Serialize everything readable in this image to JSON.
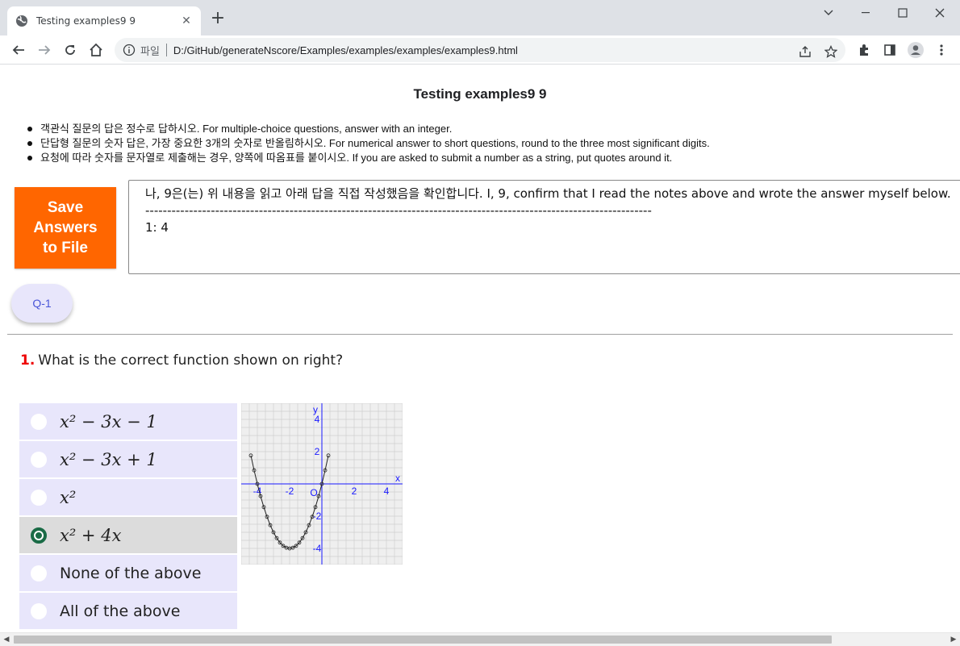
{
  "browser": {
    "tab_title": "Testing examples9 9",
    "new_tab_symbol": "+",
    "address_scheme": "파일",
    "url": "D:/GitHub/generateNscore/Examples/examples/examples/examples9.html"
  },
  "page": {
    "title": "Testing examples9 9",
    "notes": [
      "객관식 질문의 답은 정수로 답하시오. For multiple-choice questions, answer with an integer.",
      "단답형 질문의 숫자 답은, 가장 중요한 3개의 숫자로 반올림하시오. For numerical answer to short questions, round to the three most significant digits.",
      "요청에 따라 숫자를 문자열로 제출해는 경우, 양쪽에 따옴표를 붙이시오. If you are asked to submit a number as a string, put quotes around it."
    ],
    "save_button": "Save Answers to File",
    "answer_box": {
      "line1": "나, 9은(는) 위 내용을 읽고 아래 답을 직접 작성했음을 확인합니다. I, 9, confirm that I read the notes above and wrote the answer myself below.",
      "line2": "--------------------------------------------------------------------------------------------------------------------",
      "line3": "1: 4"
    },
    "question_nav": "Q-1",
    "question": {
      "number": "1.",
      "text": "What is the correct function shown on right?",
      "options": [
        {
          "label": "x² − 3x − 1",
          "selected": false
        },
        {
          "label": "x² − 3x + 1",
          "selected": false
        },
        {
          "label": "x²",
          "selected": false
        },
        {
          "label": "x² + 4x",
          "selected": true
        },
        {
          "label": "None of the above",
          "selected": false
        },
        {
          "label": "All of the above",
          "selected": false
        }
      ]
    }
  },
  "chart_data": {
    "type": "line",
    "function": "x^2 + 4x",
    "x_range": [
      -5,
      5
    ],
    "y_range": [
      -5,
      5
    ],
    "x_axis_label": "x",
    "y_axis_label": "y",
    "origin_label": "O",
    "x_ticks": [
      "-4",
      "-2",
      "2",
      "4"
    ],
    "y_ticks": [
      "4",
      "2",
      "-2",
      "-4"
    ],
    "grid": true,
    "series": [
      {
        "x": [
          -4.4,
          -4.2,
          -4.0,
          -3.8,
          -3.6,
          -3.4,
          -3.2,
          -3.0,
          -2.8,
          -2.6,
          -2.4,
          -2.2,
          -2.0,
          -1.8,
          -1.6,
          -1.4,
          -1.2,
          -1.0,
          -0.8,
          -0.6,
          -0.4,
          -0.2,
          0.0,
          0.2,
          0.4
        ],
        "y": [
          1.76,
          0.84,
          0.0,
          -0.76,
          -1.44,
          -2.04,
          -2.56,
          -3.0,
          -3.36,
          -3.64,
          -3.84,
          -3.96,
          -4.0,
          -3.96,
          -3.84,
          -3.64,
          -3.36,
          -3.0,
          -2.56,
          -2.04,
          -1.44,
          -0.76,
          0.0,
          0.84,
          1.76
        ]
      }
    ],
    "colors": {
      "axis": "#1a1aff",
      "curve": "#222222",
      "grid": "#cfcfcf",
      "background": "#efefef"
    }
  }
}
